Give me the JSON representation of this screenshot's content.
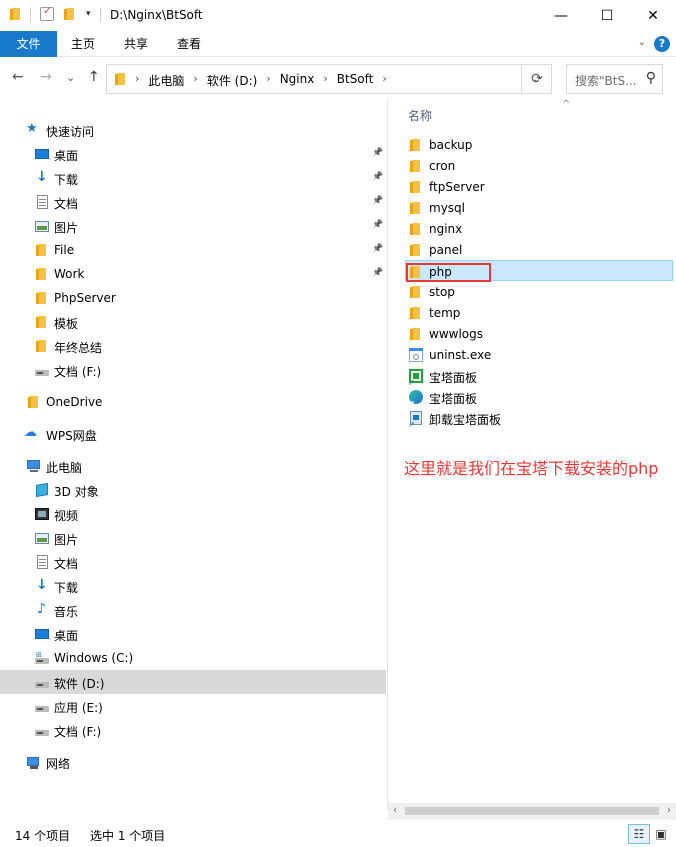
{
  "window": {
    "title": "D:\\Nginx\\BtSoft",
    "minimize": "—",
    "maximize": "☐",
    "close": "✕"
  },
  "ribbon": {
    "tabs": [
      "文件",
      "主页",
      "共享",
      "查看"
    ],
    "help": "?"
  },
  "address": {
    "crumbs": [
      "此电脑",
      "软件 (D:)",
      "Nginx",
      "BtSoft"
    ],
    "search_placeholder": "搜索\"BtS...",
    "back": "←",
    "forward": "→",
    "recent": "⌄",
    "up": "↑",
    "refresh": "⟳"
  },
  "nav": {
    "quick_access": "快速访问",
    "quick_items": [
      {
        "label": "桌面",
        "icon": "desktop-icon",
        "pinned": true
      },
      {
        "label": "下载",
        "icon": "download-icon",
        "pinned": true
      },
      {
        "label": "文档",
        "icon": "document-icon",
        "pinned": true
      },
      {
        "label": "图片",
        "icon": "picture-icon",
        "pinned": true
      },
      {
        "label": "File",
        "icon": "folder-icon",
        "pinned": true
      },
      {
        "label": "Work",
        "icon": "folder-icon",
        "pinned": true
      },
      {
        "label": "PhpServer",
        "icon": "folder-icon",
        "pinned": false
      },
      {
        "label": "模板",
        "icon": "folder-icon",
        "pinned": false
      },
      {
        "label": "年终总结",
        "icon": "folder-icon",
        "pinned": false
      },
      {
        "label": "文档 (F:)",
        "icon": "drive-icon",
        "pinned": false
      }
    ],
    "onedrive": "OneDrive",
    "wps": "WPS网盘",
    "this_pc": "此电脑",
    "pc_items": [
      {
        "label": "3D 对象",
        "icon": "3d-objects-icon"
      },
      {
        "label": "视频",
        "icon": "video-icon"
      },
      {
        "label": "图片",
        "icon": "picture-icon"
      },
      {
        "label": "文档",
        "icon": "document-icon"
      },
      {
        "label": "下载",
        "icon": "download-icon"
      },
      {
        "label": "音乐",
        "icon": "music-icon"
      },
      {
        "label": "桌面",
        "icon": "desktop-icon"
      },
      {
        "label": "Windows (C:)",
        "icon": "windows-drive-icon"
      },
      {
        "label": "软件 (D:)",
        "icon": "drive-icon",
        "selected": true
      },
      {
        "label": "应用 (E:)",
        "icon": "drive-icon"
      },
      {
        "label": "文档 (F:)",
        "icon": "drive-icon"
      }
    ],
    "network": "网络"
  },
  "content": {
    "column_header": "名称",
    "files": [
      {
        "name": "backup",
        "icon": "folder-icon"
      },
      {
        "name": "cron",
        "icon": "folder-icon"
      },
      {
        "name": "ftpServer",
        "icon": "folder-icon"
      },
      {
        "name": "mysql",
        "icon": "folder-icon"
      },
      {
        "name": "nginx",
        "icon": "folder-icon"
      },
      {
        "name": "panel",
        "icon": "folder-icon"
      },
      {
        "name": "php",
        "icon": "folder-icon",
        "selected": true
      },
      {
        "name": "stop",
        "icon": "folder-icon"
      },
      {
        "name": "temp",
        "icon": "folder-icon"
      },
      {
        "name": "wwwlogs",
        "icon": "folder-icon"
      },
      {
        "name": "uninst.exe",
        "icon": "exe-icon"
      },
      {
        "name": "宝塔面板",
        "icon": "bt-panel-icon"
      },
      {
        "name": "宝塔面板",
        "icon": "bt-panel-edge-icon"
      },
      {
        "name": "卸载宝塔面板",
        "icon": "uninstall-shortcut-icon"
      }
    ],
    "annotation": "这里就是我们在宝塔下载安装的php"
  },
  "status": {
    "count": "14 个项目",
    "selected": "选中 1 个项目"
  },
  "colors": {
    "accent": "#1979ca",
    "selection": "#cce8ff",
    "annotation": "#e53935",
    "folder": "#f5c144"
  }
}
